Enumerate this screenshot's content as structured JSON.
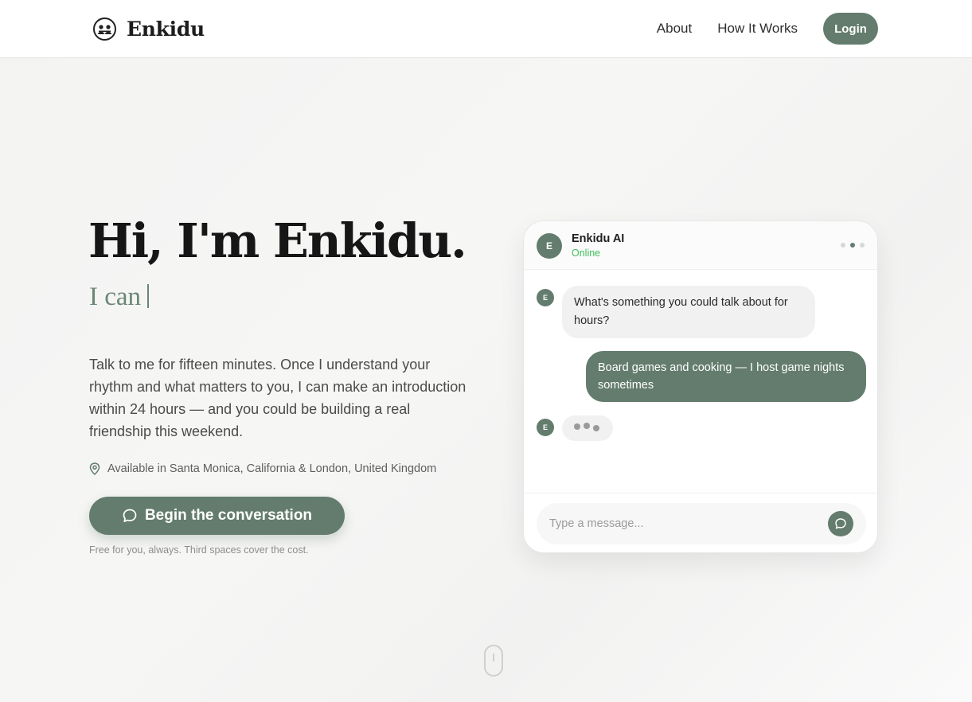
{
  "brand": {
    "name": "Enkidu",
    "logo_icon": "friends-logo-icon"
  },
  "nav": {
    "links": [
      "About",
      "How It Works"
    ],
    "login_label": "Login"
  },
  "hero": {
    "title": "Hi, I'm Enkidu.",
    "subtitle": "I can",
    "description": "Talk to me for fifteen minutes. Once I understand your rhythm and what matters to you, I can make an introduction within 24 hours — and you could be building a real friendship this weekend.",
    "availability": "Available in Santa Monica, California & London, United Kingdom",
    "cta_label": "Begin the conversation",
    "cta_note": "Free for you, always. Third spaces cover the cost."
  },
  "chat": {
    "avatar_letter": "E",
    "name": "Enkidu AI",
    "status": "Online",
    "messages": [
      {
        "from": "bot",
        "avatar": "E",
        "text": "What's something you could talk about for hours?"
      },
      {
        "from": "user",
        "text": "Board games and cooking — I host game nights sometimes"
      }
    ],
    "typing_avatar": "E",
    "input_placeholder": "Type a message..."
  },
  "colors": {
    "accent": "#637c6d",
    "online": "#3fbf5a",
    "subtitle": "#6b8677"
  }
}
